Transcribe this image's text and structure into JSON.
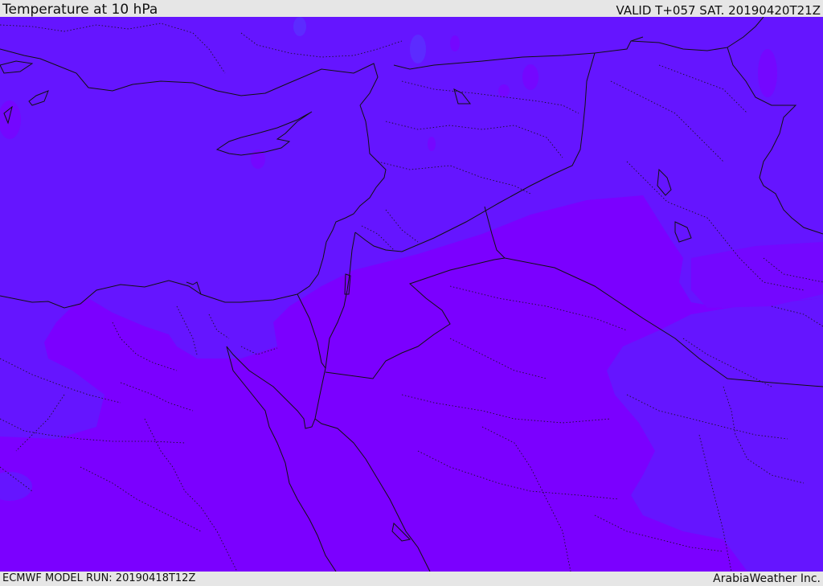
{
  "header": {
    "title": "Temperature at 10 hPa",
    "valid_time": "VALID T+057 SAT. 20190420T21Z"
  },
  "footer": {
    "model_run": "ECMWF MODEL RUN: 20190418T12Z",
    "credit": "ArabiaWeather Inc."
  },
  "map": {
    "field": "temperature",
    "level": "10 hPa",
    "colors": {
      "cold_band": "#6515ff",
      "warm_band": "#7b00ff",
      "transition": "#6f0cff",
      "borders": "#111111"
    }
  }
}
